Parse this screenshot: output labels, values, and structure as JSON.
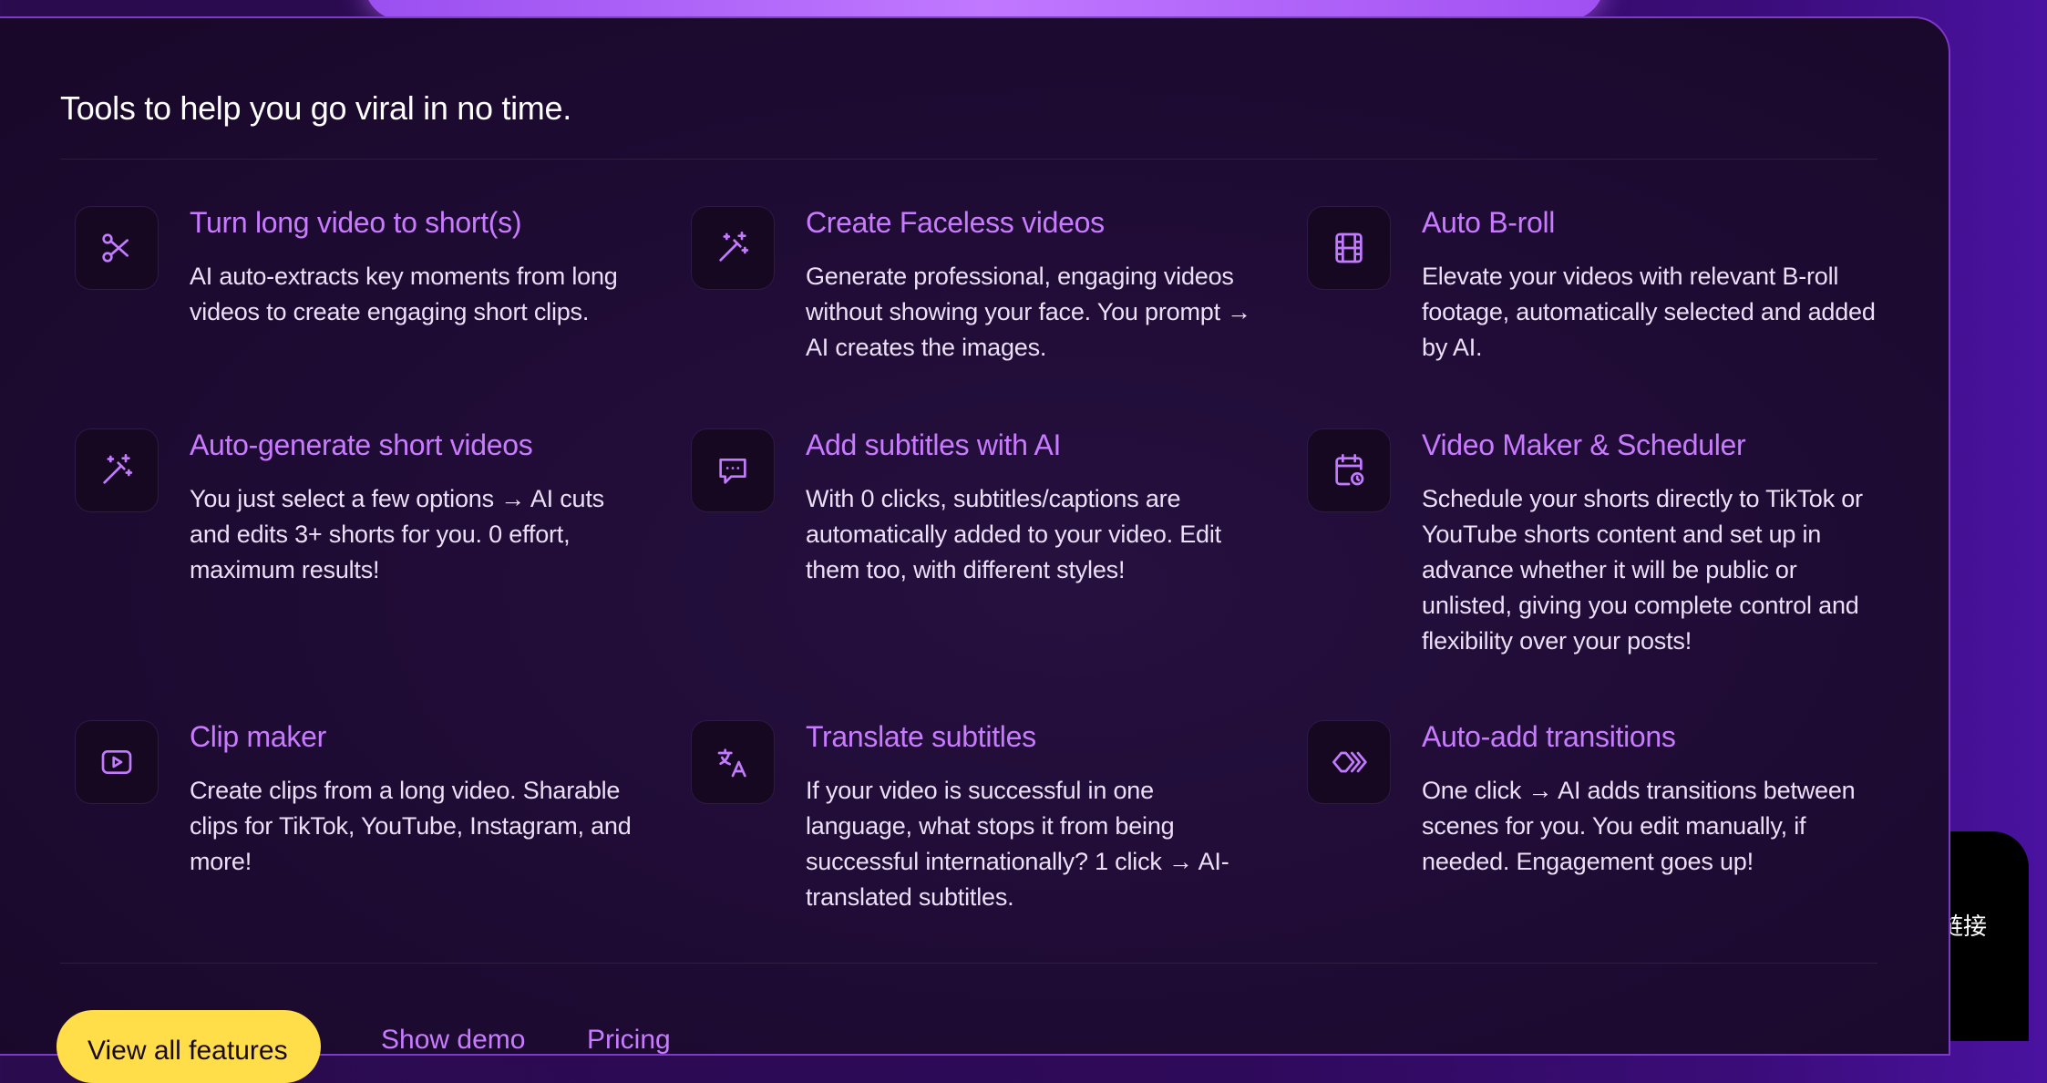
{
  "section": {
    "heading": "Tools to help you go viral in no time."
  },
  "features": [
    {
      "title": "Turn long video to short(s)",
      "description": "AI auto-extracts key moments from long videos to create engaging short clips.",
      "icon": "scissors-icon"
    },
    {
      "title": "Create Faceless videos",
      "description": "Generate professional, engaging videos without showing your face. You prompt → AI creates the images.",
      "icon": "magic-wand-icon"
    },
    {
      "title": "Auto B-roll",
      "description": "Elevate your videos with relevant B-roll footage, automatically selected and added by AI.",
      "icon": "film-icon"
    },
    {
      "title": "Auto-generate short videos",
      "description": "You just select a few options → AI cuts and edits 3+ shorts for you. 0 effort, maximum results!",
      "icon": "magic-wand-icon"
    },
    {
      "title": "Add subtitles with AI",
      "description": "With 0 clicks, subtitles/captions are automatically added to your video. Edit them too, with different styles!",
      "icon": "chat-bubble-icon"
    },
    {
      "title": "Video Maker & Scheduler",
      "description": "Schedule your shorts directly to TikTok or YouTube shorts content and set up in advance whether it will be public or unlisted, giving you complete control and flexibility over your posts!",
      "icon": "calendar-clock-icon"
    },
    {
      "title": "Clip maker",
      "description": "Create clips from a long video. Sharable clips for TikTok, YouTube, Instagram, and more!",
      "icon": "play-button-icon"
    },
    {
      "title": "Translate subtitles",
      "description": "If your video is successful in one language, what stops it from being successful internationally? 1 click → AI-translated subtitles.",
      "icon": "translate-icon"
    },
    {
      "title": "Auto-add transitions",
      "description": "One click → AI adds transitions between scenes for you. You edit manually, if needed. Engagement goes up!",
      "icon": "chevrons-right-icon"
    }
  ],
  "cta": {
    "primary_label": "View all features",
    "link1_label": "Show demo",
    "link2_label": "Pricing"
  },
  "side_panel": {
    "text": "链接"
  },
  "colors": {
    "accent": "#c97bff",
    "cta": "#ffde4a",
    "card_background": "#1e0b33"
  }
}
